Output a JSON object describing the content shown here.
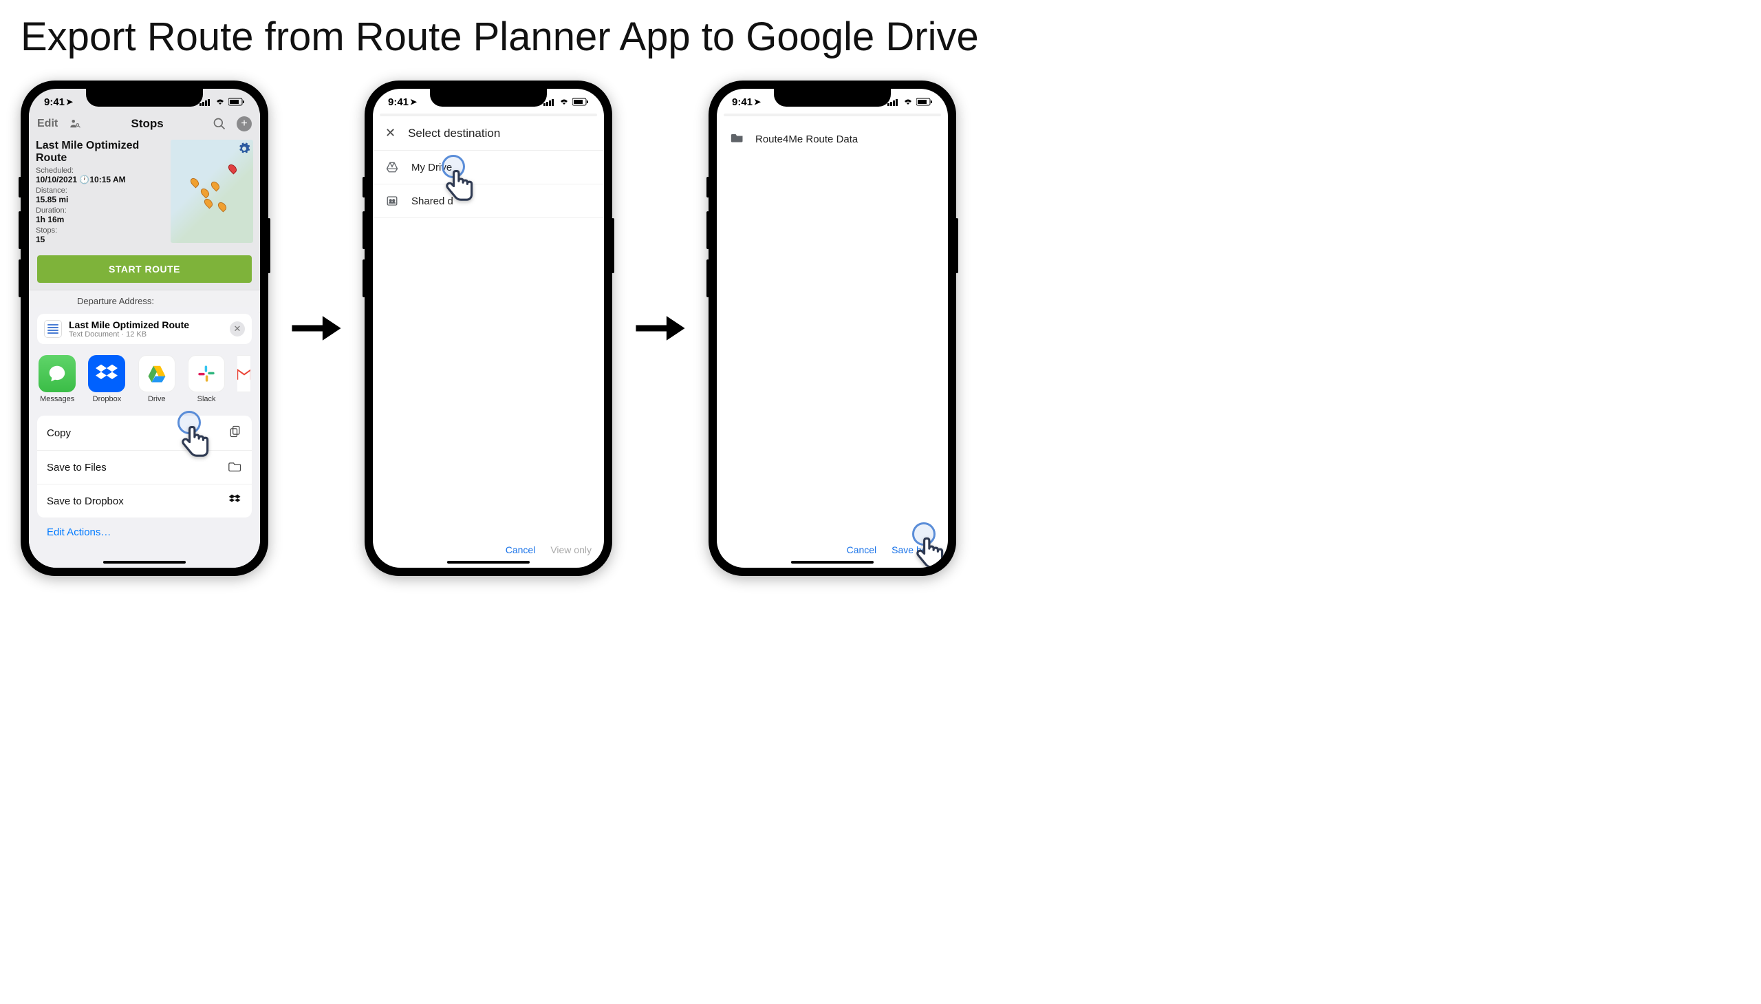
{
  "page": {
    "title": "Export Route from Route Planner App to Google Drive"
  },
  "status": {
    "time": "9:41"
  },
  "phone1": {
    "nav": {
      "edit": "Edit",
      "title": "Stops"
    },
    "route": {
      "name": "Last Mile Optimized Route",
      "scheduled_label": "Scheduled:",
      "scheduled_date": "10/10/2021",
      "scheduled_time": "10:15 AM",
      "distance_label": "Distance:",
      "distance": "15.85 mi",
      "duration_label": "Duration:",
      "duration": "1h 16m",
      "stops_label": "Stops:",
      "stops": "15"
    },
    "start_button": "START ROUTE",
    "departure_label": "Departure Address:",
    "share": {
      "file_name": "Last Mile Optimized Route",
      "file_meta": "Text Document · 12 KB",
      "apps": {
        "messages": "Messages",
        "dropbox": "Dropbox",
        "drive": "Drive",
        "slack": "Slack"
      },
      "actions": {
        "copy": "Copy",
        "save_files": "Save to Files",
        "save_dropbox": "Save to Dropbox",
        "edit_actions": "Edit Actions…"
      }
    }
  },
  "phone2": {
    "header": "Select destination",
    "my_drive": "My Drive",
    "shared_drives": "Shared d",
    "cancel": "Cancel",
    "view_only": "View only"
  },
  "phone3": {
    "folder": "Route4Me Route Data",
    "cancel": "Cancel",
    "save_here": "Save here"
  }
}
